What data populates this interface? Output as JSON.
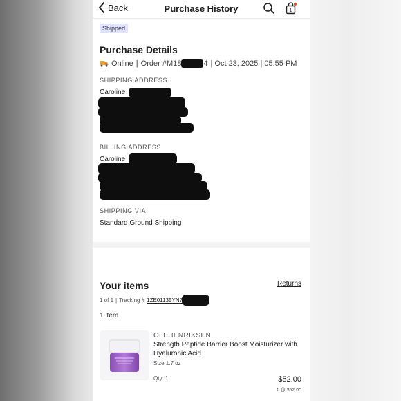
{
  "header": {
    "back_label": "Back",
    "title": "Purchase History"
  },
  "status_badge": "Shipped",
  "details": {
    "title": "Purchase Details",
    "channel": "Online",
    "order_prefix": "Order #M18",
    "order_suffix": "4",
    "date_time": "| Oct 23, 2025 | 05:55 PM",
    "sep": "|"
  },
  "shipping_address": {
    "label": "SHIPPING ADDRESS",
    "name": "Caroline"
  },
  "billing_address": {
    "label": "BILLING ADDRESS",
    "name": "Caroline"
  },
  "shipping_via": {
    "label": "SHIPPING VIA",
    "value": "Standard Ground Shipping"
  },
  "items": {
    "title": "Your items",
    "returns_label": "Returns",
    "package": "1 of 1",
    "sep": "|",
    "tracking_label": "Tracking #",
    "tracking_number": "1ZE01135YN7",
    "count_label": "1 item",
    "list": [
      {
        "brand": "OLEHENRIKSEN",
        "name": "Strength Peptide Barrier Boost Moisturizer with Hyaluronic Acid",
        "size": "Size 1.7 oz",
        "qty": "Qty: 1",
        "price": "$52.00",
        "unit": "1 @ $52.00"
      }
    ]
  },
  "colors": {
    "badge_bg": "#dfe3ff",
    "jar_purple": "#9b5fc0",
    "redaction": "#111111"
  }
}
